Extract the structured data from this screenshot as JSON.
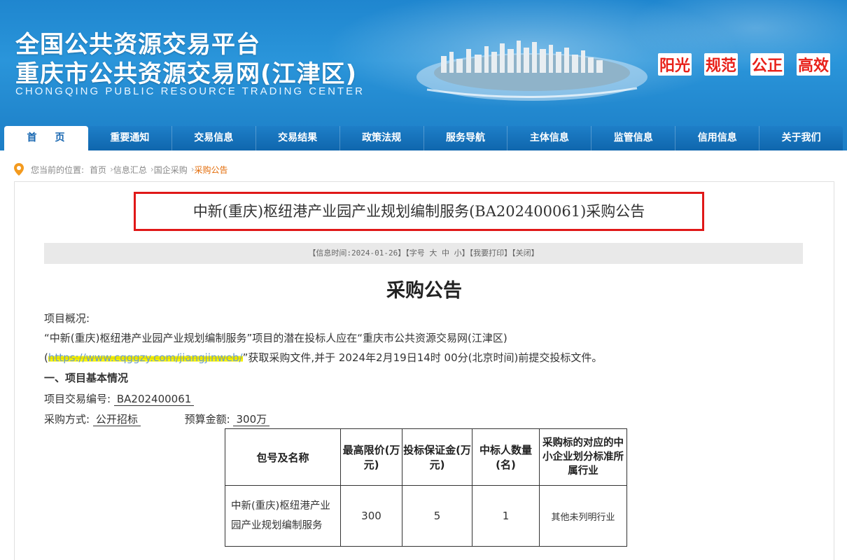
{
  "header": {
    "title_line1": "全国公共资源交易平台",
    "title_line2": "重庆市公共资源交易网(江津区)",
    "title_en": "CHONGQING PUBLIC RESOURCE TRADING CENTER",
    "slogans": [
      "阳光",
      "规范",
      "公正",
      "高效"
    ]
  },
  "nav": {
    "items": [
      "首页",
      "重要通知",
      "交易信息",
      "交易结果",
      "政策法规",
      "服务导航",
      "主体信息",
      "监管信息",
      "信用信息",
      "关于我们"
    ],
    "active_index": 0
  },
  "breadcrumb": {
    "prefix": "您当前的位置:",
    "items": [
      "首页",
      "信息汇总",
      "国企采购",
      "采购公告"
    ]
  },
  "announcement": {
    "title": "中新(重庆)枢纽港产业园产业规划编制服务(BA202400061)采购公告",
    "info_prefix": "【信息时间:2024-01-26】【字号",
    "font_large": "大",
    "font_medium": "中",
    "font_small": "小",
    "info_mid": "】【",
    "print": "我要打印",
    "close": "关闭",
    "info_end": "】",
    "heading": "采购公告",
    "overview_label": "项目概况:",
    "overview_line1": "“中新(重庆)枢纽港产业园产业规划编制服务”项目的潜在投标人应在“重庆市公共资源交易网(江津区)",
    "overview_open": "(",
    "overview_url": "https://www.cqggzy.com/jiangjinweb/",
    "overview_line2_rest": "”获取采购文件,并于 2024年2月19日14时 00分(北京时间)前提交投标文件。",
    "section1": "一、项目基本情况",
    "project_no_label": "项目交易编号:",
    "project_no": "BA202400061",
    "method_label": "采购方式:",
    "method": "公开招标",
    "budget_label": "预算金额:",
    "budget": "300万"
  },
  "table": {
    "headers": [
      "包号及名称",
      "最高限价(万元)",
      "投标保证金(万元)",
      "中标人数量(名)",
      "采购标的对应的中小企业划分标准所属行业"
    ],
    "rows": [
      [
        "中新(重庆)枢纽港产业园产业规划编制服务",
        "300",
        "5",
        "1",
        "其他未列明行业"
      ]
    ]
  },
  "colors": {
    "nav_blue": "#1565b0",
    "slogan_red": "#e8211a",
    "highlight_box": "#e01818",
    "current_crumb": "#e36c09"
  }
}
